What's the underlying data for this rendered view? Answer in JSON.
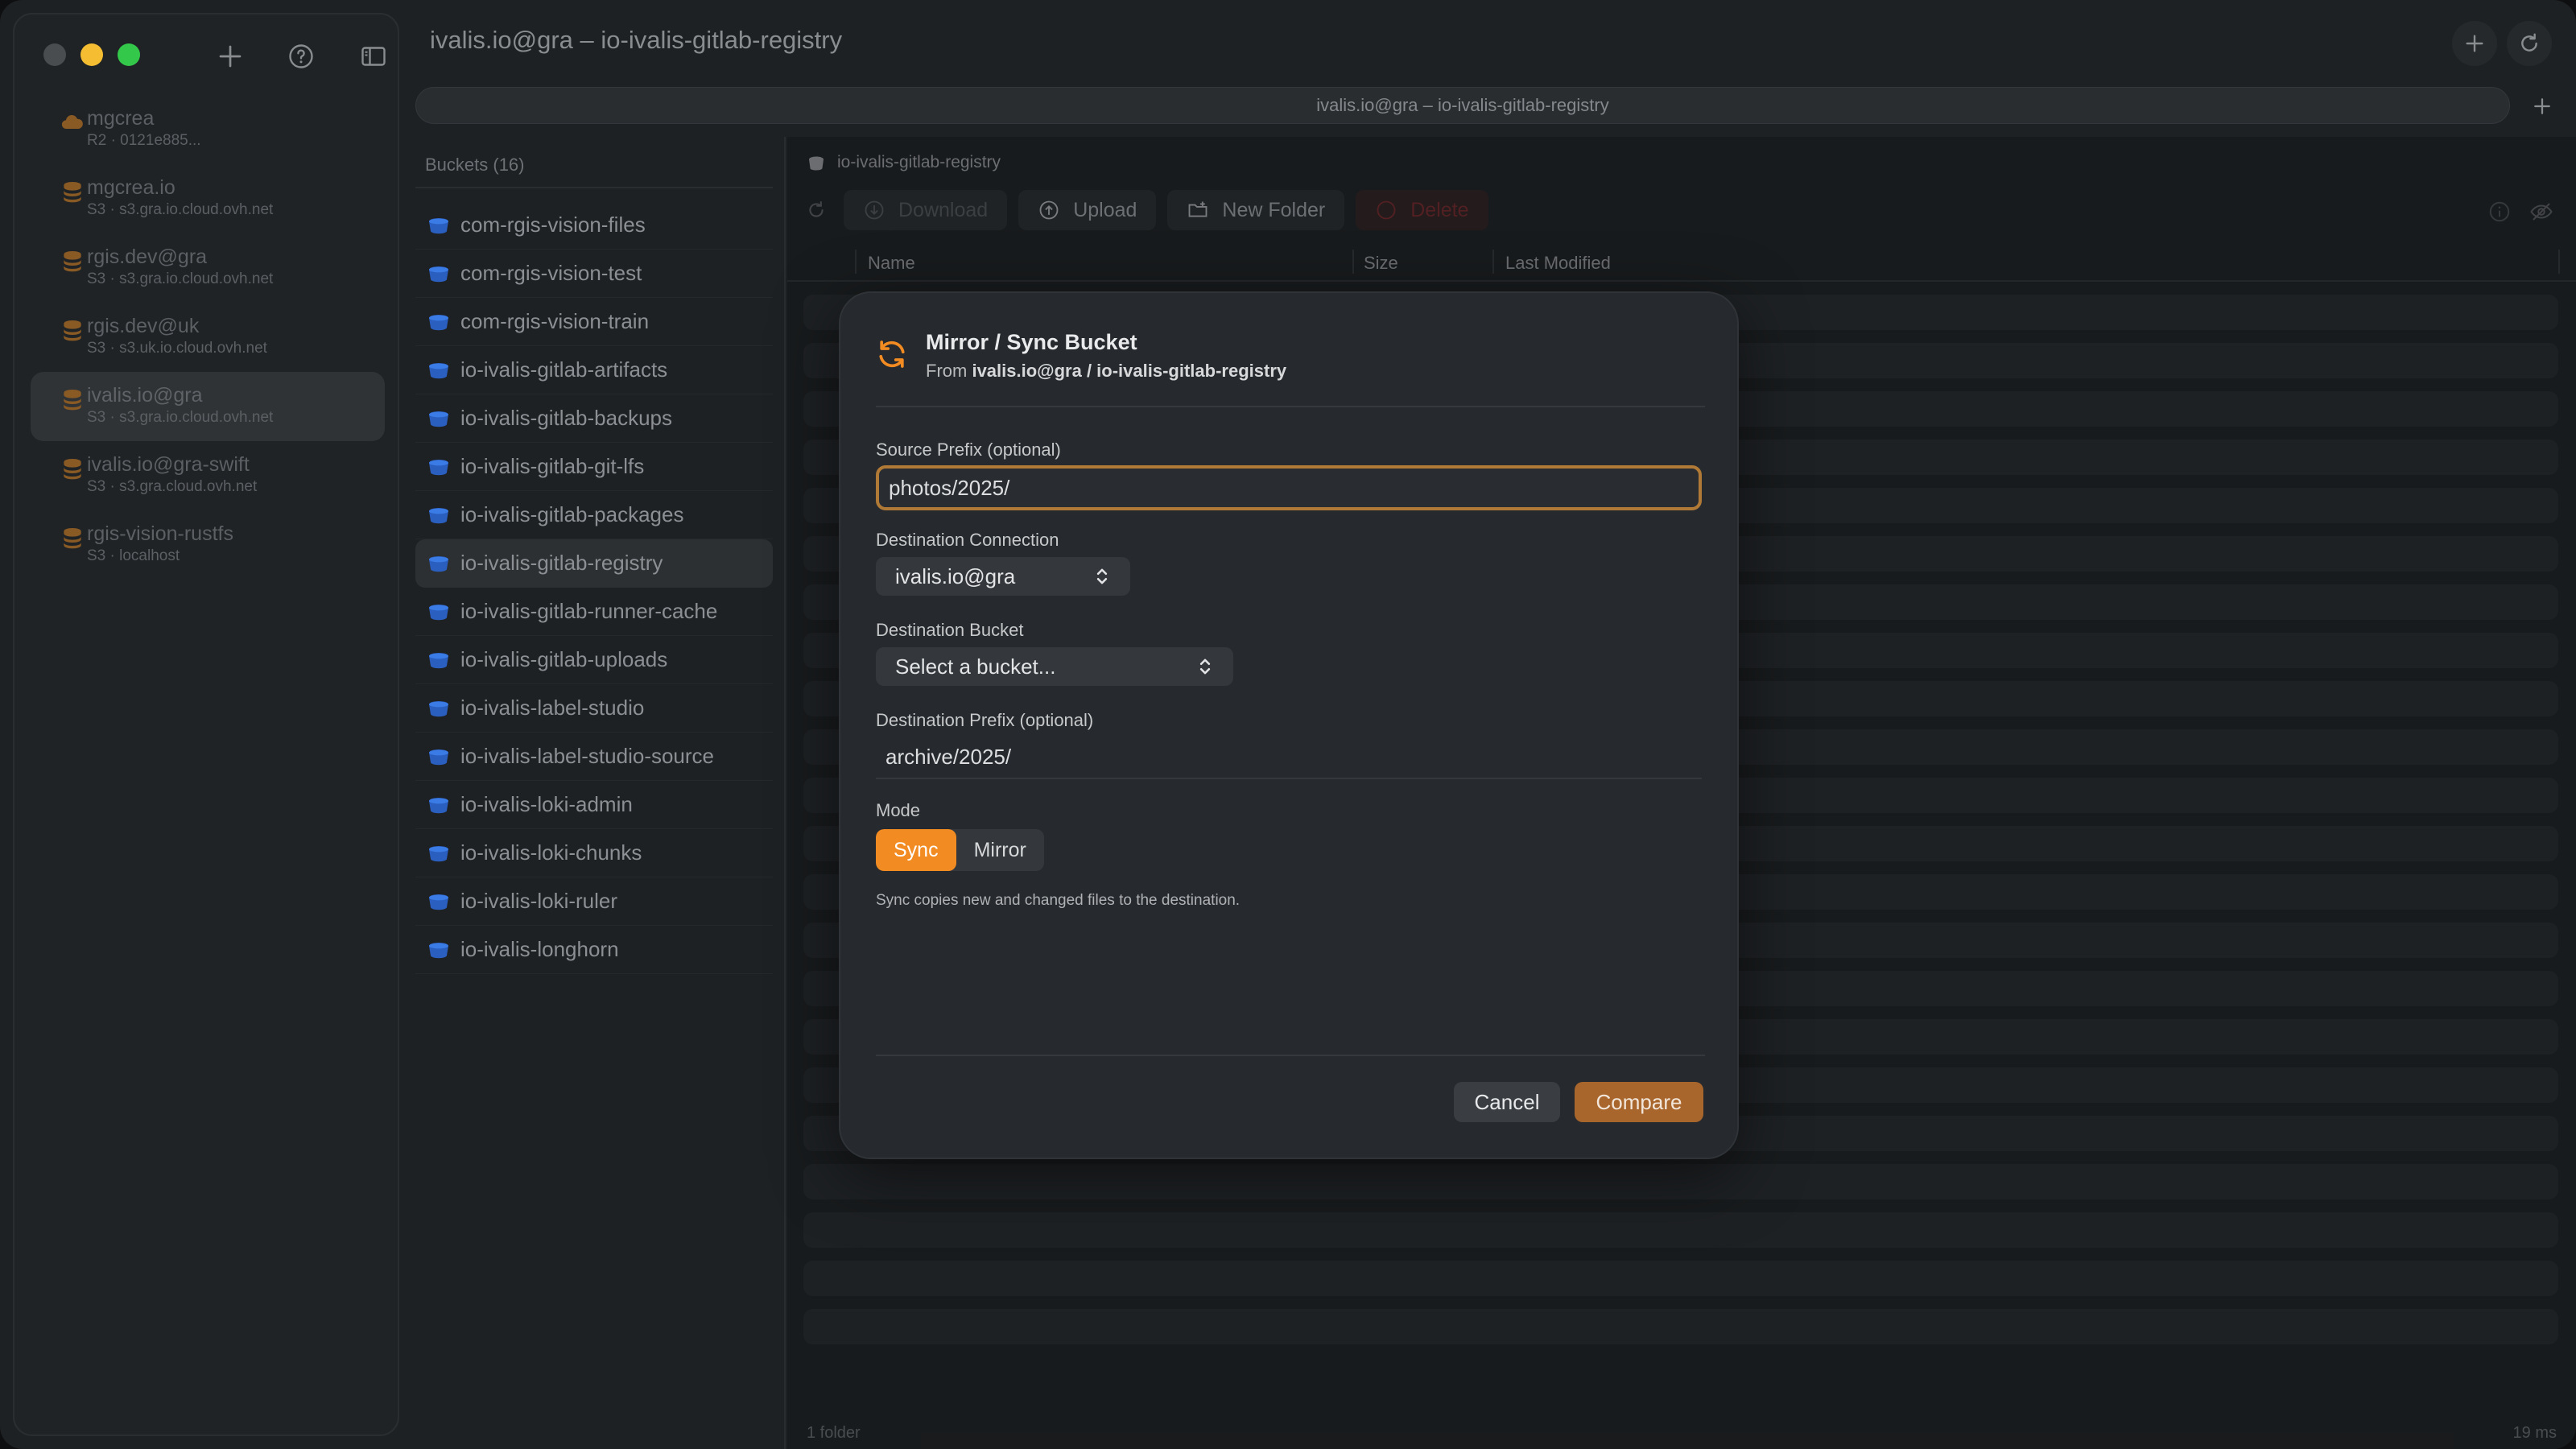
{
  "window": {
    "title": "ivalis.io@gra – io-ivalis-gitlab-registry"
  },
  "tab": {
    "title": "ivalis.io@gra – io-ivalis-gitlab-registry"
  },
  "sidebar": {
    "connections": [
      {
        "name": "mgcrea",
        "sub": "R2 · 0121e885..."
      },
      {
        "name": "mgcrea.io",
        "sub": "S3 · s3.gra.io.cloud.ovh.net"
      },
      {
        "name": "rgis.dev@gra",
        "sub": "S3 · s3.gra.io.cloud.ovh.net"
      },
      {
        "name": "rgis.dev@uk",
        "sub": "S3 · s3.uk.io.cloud.ovh.net"
      },
      {
        "name": "ivalis.io@gra",
        "sub": "S3 · s3.gra.io.cloud.ovh.net"
      },
      {
        "name": "ivalis.io@gra-swift",
        "sub": "S3 · s3.gra.cloud.ovh.net"
      },
      {
        "name": "rgis-vision-rustfs",
        "sub": "S3 · localhost"
      }
    ],
    "active_index": 4
  },
  "buckets": {
    "header": "Buckets (16)",
    "items": [
      "com-rgis-vision-files",
      "com-rgis-vision-test",
      "com-rgis-vision-train",
      "io-ivalis-gitlab-artifacts",
      "io-ivalis-gitlab-backups",
      "io-ivalis-gitlab-git-lfs",
      "io-ivalis-gitlab-packages",
      "io-ivalis-gitlab-registry",
      "io-ivalis-gitlab-runner-cache",
      "io-ivalis-gitlab-uploads",
      "io-ivalis-label-studio",
      "io-ivalis-label-studio-source",
      "io-ivalis-loki-admin",
      "io-ivalis-loki-chunks",
      "io-ivalis-loki-ruler",
      "io-ivalis-longhorn"
    ],
    "active_index": 7
  },
  "main": {
    "breadcrumb": "io-ivalis-gitlab-registry",
    "toolbar": {
      "download": "Download",
      "upload": "Upload",
      "new_folder": "New Folder",
      "delete": "Delete"
    },
    "columns": {
      "name": "Name",
      "size": "Size",
      "modified": "Last Modified"
    },
    "status_left": "1 folder",
    "status_right": "19 ms"
  },
  "modal": {
    "title": "Mirror / Sync Bucket",
    "from_prefix": "From ",
    "from_value": "ivalis.io@gra / io-ivalis-gitlab-registry",
    "source_prefix_label": "Source Prefix (optional)",
    "source_prefix_value": "photos/2025/",
    "dest_connection_label": "Destination Connection",
    "dest_connection_value": "ivalis.io@gra",
    "dest_bucket_label": "Destination Bucket",
    "dest_bucket_value": "Select a bucket...",
    "dest_prefix_label": "Destination Prefix (optional)",
    "dest_prefix_value": "archive/2025/",
    "mode_label": "Mode",
    "mode_sync": "Sync",
    "mode_mirror": "Mirror",
    "mode_selected": "Sync",
    "hint": "Sync copies new and changed files to the destination.",
    "cancel": "Cancel",
    "compare": "Compare"
  },
  "colors": {
    "accent": "#f28c22",
    "compare": "#a8662c",
    "bucket_icon": "#2f6fd8",
    "connection_icon": "#c27a2a"
  }
}
